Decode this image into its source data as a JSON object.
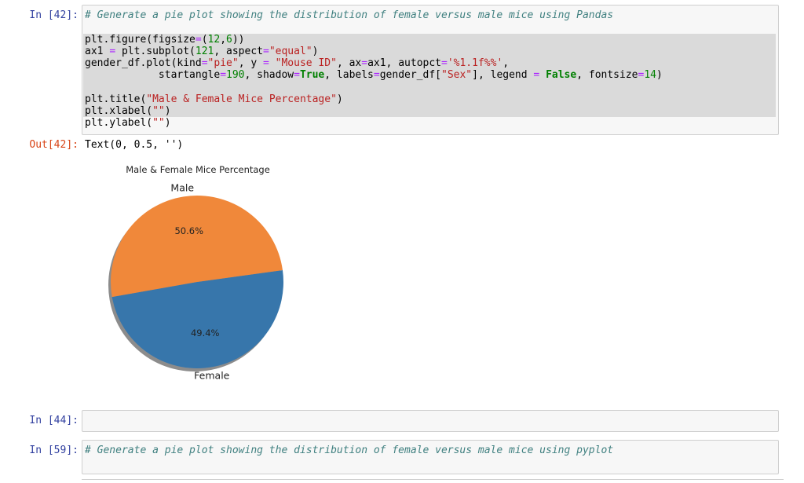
{
  "cells": {
    "c42": {
      "prompt": "In [42]:",
      "comment": "# Generate a pie plot showing the distribution of female versus male mice using Pandas",
      "code": {
        "l1": [
          "plt.figure(figsize",
          "=",
          "(",
          "12",
          ",",
          "6",
          "))"
        ],
        "l2": [
          "ax1 ",
          "=",
          " plt.subplot(",
          "121",
          ", aspect",
          "=",
          "\"equal\"",
          ")"
        ],
        "l3": [
          "gender_df.plot(kind",
          "=",
          "\"pie\"",
          ", y ",
          "=",
          " ",
          "\"Mouse ID\"",
          ", ax",
          "=",
          "ax1, autopct",
          "=",
          "'%1.1f%%'",
          ","
        ],
        "l4": [
          "            startangle",
          "=",
          "190",
          ", shadow",
          "=",
          "True",
          ", labels",
          "=",
          "gender_df[",
          "\"Sex\"",
          "], legend ",
          "=",
          " ",
          "False",
          ", fontsize",
          "=",
          "14",
          ")"
        ],
        "l5": [
          "plt.title(",
          "\"Male & Female Mice Percentage\"",
          ")"
        ],
        "l6": [
          "plt.xlabel(",
          "\"\"",
          ")"
        ],
        "l7": [
          "plt.ylabel(",
          "\"\"",
          ")"
        ]
      },
      "out_prompt": "Out[42]:",
      "out_text": "Text(0, 0.5, '')"
    },
    "c44": {
      "prompt": "In [44]:"
    },
    "c59": {
      "prompt": "In [59]:",
      "comment": "# Generate a pie plot showing the distribution of female versus male mice using pyplot"
    }
  },
  "chart_data": {
    "type": "pie",
    "title": "Male & Female Mice Percentage",
    "categories": [
      "Female",
      "Male"
    ],
    "values": [
      49.4,
      50.6
    ],
    "labels": [
      "Female",
      "Male"
    ],
    "pct_labels": [
      "49.4%",
      "50.6%"
    ],
    "startangle": 190,
    "shadow": true,
    "colors": [
      "#3776ab",
      "#f0883a"
    ]
  }
}
